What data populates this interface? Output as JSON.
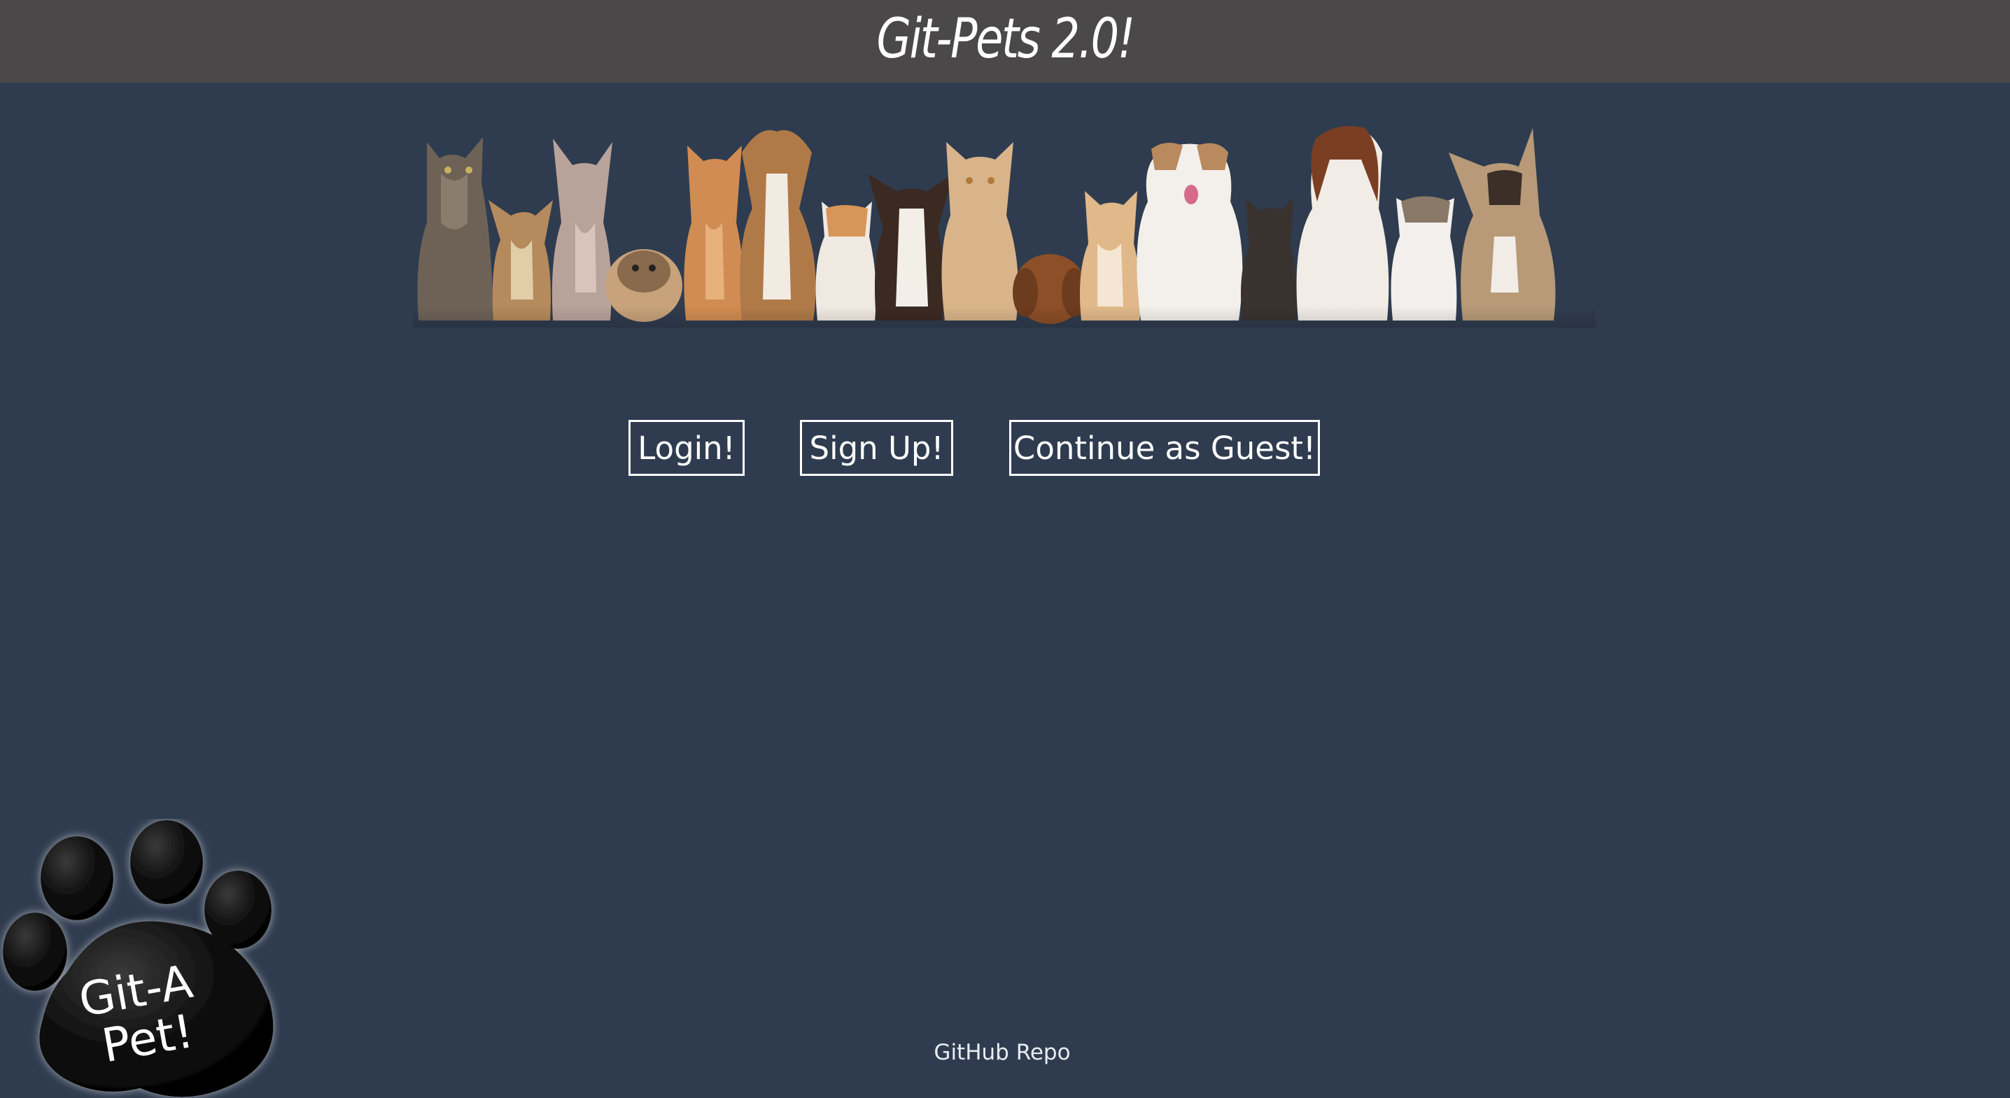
{
  "header": {
    "title": "Git-Pets 2.0!"
  },
  "banner": {
    "subject": "row of cats and dogs"
  },
  "actions": {
    "login_label": "Login!",
    "signup_label": "Sign Up!",
    "guest_label": "Continue as Guest!"
  },
  "logo": {
    "line1": "Git-A",
    "line2": "Pet!"
  },
  "footer": {
    "repo_link": "GitHub Repo"
  },
  "colors": {
    "background": "#2f3c4f",
    "header_bar": "#4a4849",
    "text": "#ffffff"
  }
}
